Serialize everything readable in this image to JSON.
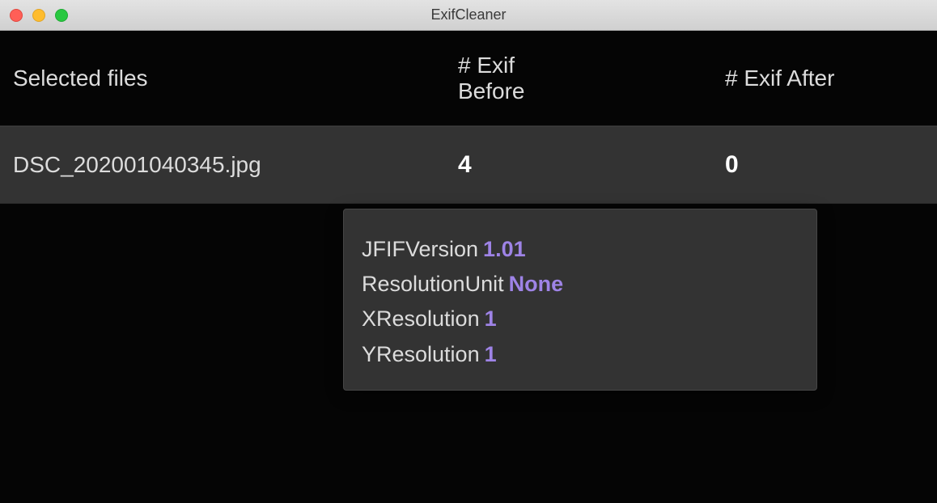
{
  "window": {
    "title": "ExifCleaner"
  },
  "table": {
    "headers": {
      "files": "Selected files",
      "before": "# Exif Before",
      "after": "# Exif After"
    },
    "rows": [
      {
        "filename": "DSC_202001040345.jpg",
        "before": "4",
        "after": "0"
      }
    ]
  },
  "tooltip": {
    "entries": [
      {
        "key": "JFIFVersion",
        "value": "1.01"
      },
      {
        "key": "ResolutionUnit",
        "value": "None"
      },
      {
        "key": "XResolution",
        "value": "1"
      },
      {
        "key": "YResolution",
        "value": "1"
      }
    ]
  }
}
